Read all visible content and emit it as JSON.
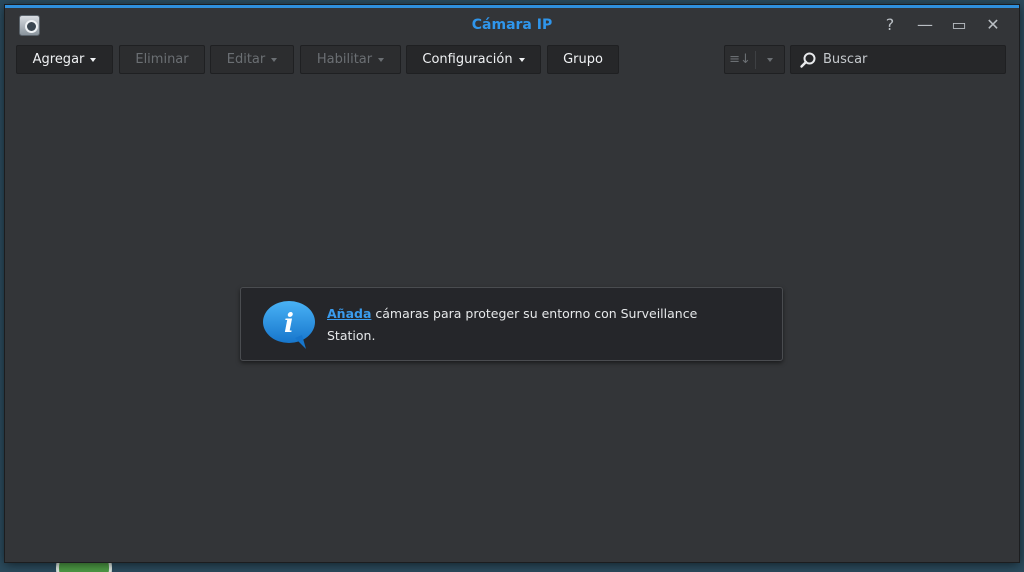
{
  "window": {
    "title": "Cámara IP",
    "accent_color": "#2f8fdc",
    "controls": {
      "help": "?",
      "minimize": "—",
      "maximize": "▭",
      "close": "✕"
    }
  },
  "toolbar": {
    "add_label": "Agregar",
    "delete_label": "Eliminar",
    "edit_label": "Editar",
    "enable_label": "Habilitar",
    "config_label": "Configuración",
    "group_label": "Grupo",
    "sort_icon": "≡↓"
  },
  "search": {
    "placeholder": "Buscar",
    "value": ""
  },
  "notice": {
    "link_text": "Añada",
    "message": " cámaras para proteger su entorno con Surveillance Station."
  }
}
